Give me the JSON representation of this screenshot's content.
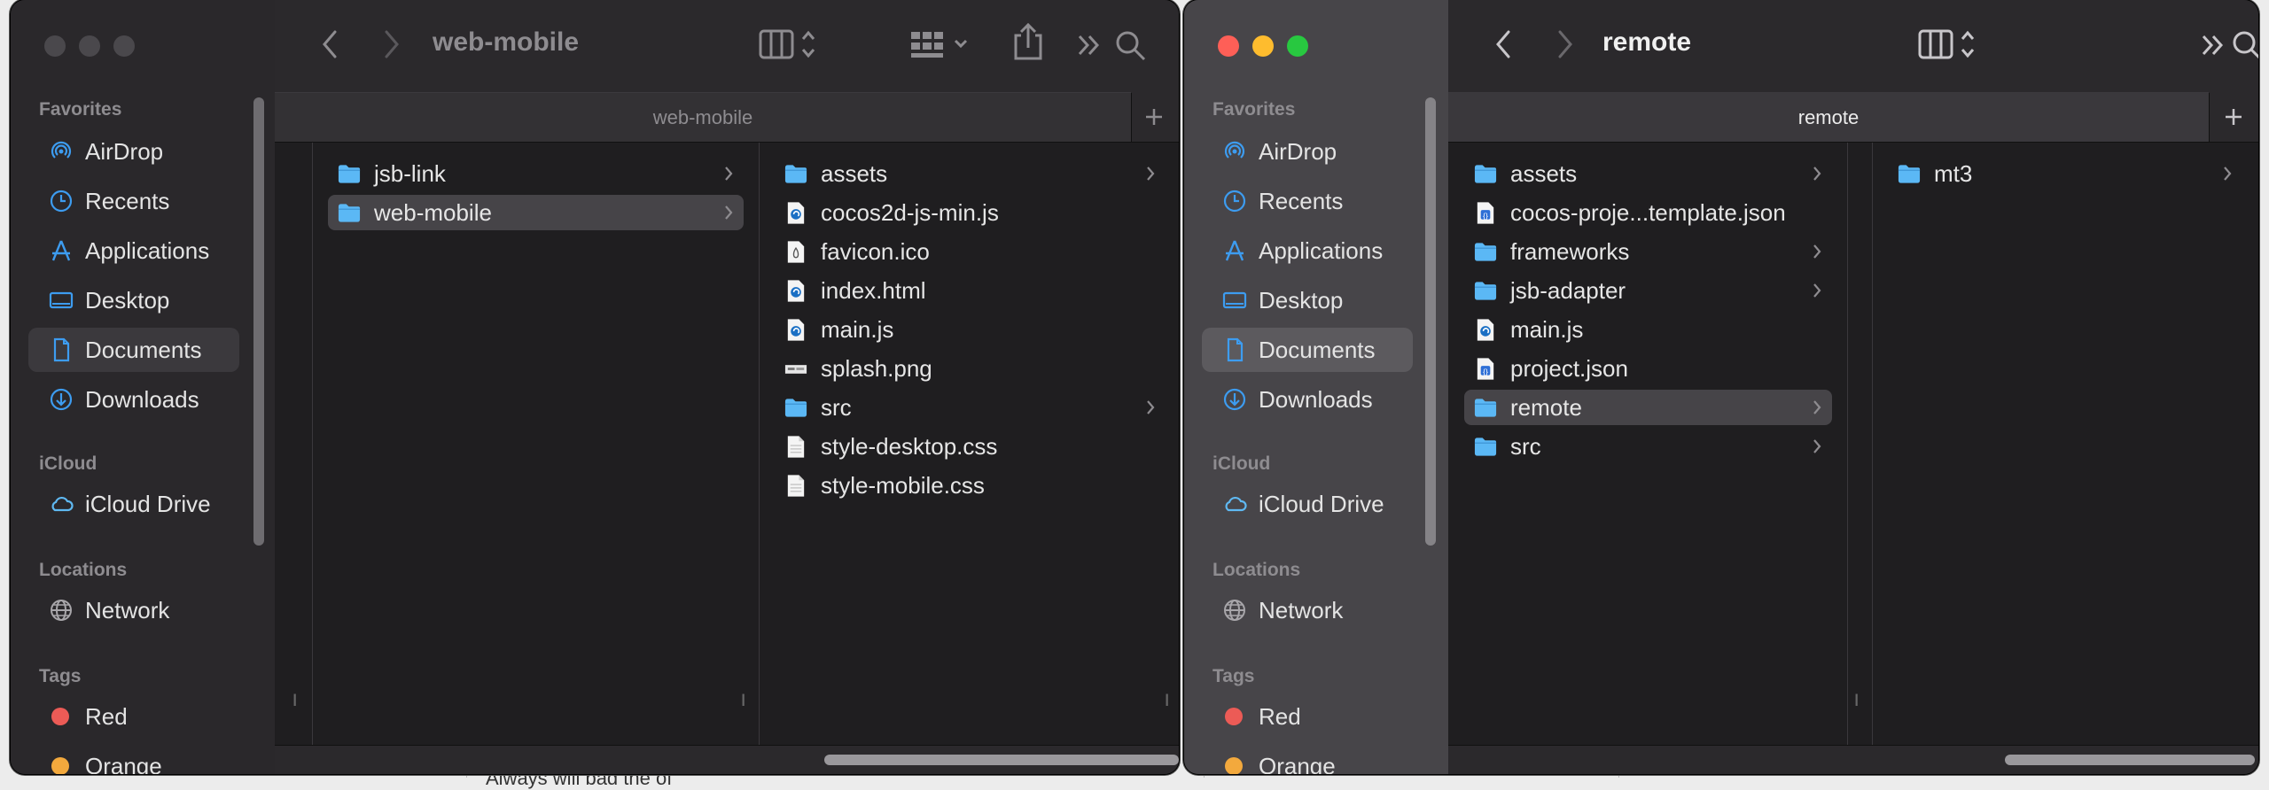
{
  "background": {
    "partial_text": "Always     will bad     the       of    "
  },
  "sidebar": {
    "favorites_label": "Favorites",
    "favorites": [
      {
        "label": "AirDrop",
        "icon": "airdrop-icon"
      },
      {
        "label": "Recents",
        "icon": "clock-icon"
      },
      {
        "label": "Applications",
        "icon": "applications-icon"
      },
      {
        "label": "Desktop",
        "icon": "desktop-icon"
      },
      {
        "label": "Documents",
        "icon": "document-icon"
      },
      {
        "label": "Downloads",
        "icon": "download-icon"
      }
    ],
    "icloud_label": "iCloud",
    "icloud_drive": "iCloud Drive",
    "locations_label": "Locations",
    "network": "Network",
    "tags_label": "Tags",
    "tags": [
      {
        "label": "Red",
        "color": "#ec5b56"
      },
      {
        "label": "Orange",
        "color": "#f3a93d"
      }
    ],
    "selected": "Documents"
  },
  "window1": {
    "title": "web-mobile",
    "tab": "web-mobile",
    "col1": [
      {
        "name": "jsb-link",
        "kind": "folder",
        "has_children": true
      },
      {
        "name": "web-mobile",
        "kind": "folder",
        "has_children": true,
        "selected": true
      }
    ],
    "col2": [
      {
        "name": "assets",
        "kind": "folder",
        "has_children": true
      },
      {
        "name": "cocos2d-js-min.js",
        "kind": "js"
      },
      {
        "name": "favicon.ico",
        "kind": "ico"
      },
      {
        "name": "index.html",
        "kind": "html"
      },
      {
        "name": "main.js",
        "kind": "js"
      },
      {
        "name": "splash.png",
        "kind": "png"
      },
      {
        "name": "src",
        "kind": "folder",
        "has_children": true
      },
      {
        "name": "style-desktop.css",
        "kind": "doc"
      },
      {
        "name": "style-mobile.css",
        "kind": "doc"
      }
    ]
  },
  "window2": {
    "title": "remote",
    "tab": "remote",
    "col1": [
      {
        "name": "assets",
        "kind": "folder",
        "has_children": true
      },
      {
        "name": "cocos-proje...template.json",
        "kind": "json"
      },
      {
        "name": "frameworks",
        "kind": "folder",
        "has_children": true
      },
      {
        "name": "jsb-adapter",
        "kind": "folder",
        "has_children": true
      },
      {
        "name": "main.js",
        "kind": "js"
      },
      {
        "name": "project.json",
        "kind": "json"
      },
      {
        "name": "remote",
        "kind": "folder",
        "has_children": true,
        "selected": true
      },
      {
        "name": "src",
        "kind": "folder",
        "has_children": true
      }
    ],
    "col2": [
      {
        "name": "mt3",
        "kind": "folder",
        "has_children": true
      }
    ]
  },
  "colors": {
    "folder": "#5bb8f5",
    "accent": "#3d9cf0",
    "window_bg": "#1f1e20"
  }
}
